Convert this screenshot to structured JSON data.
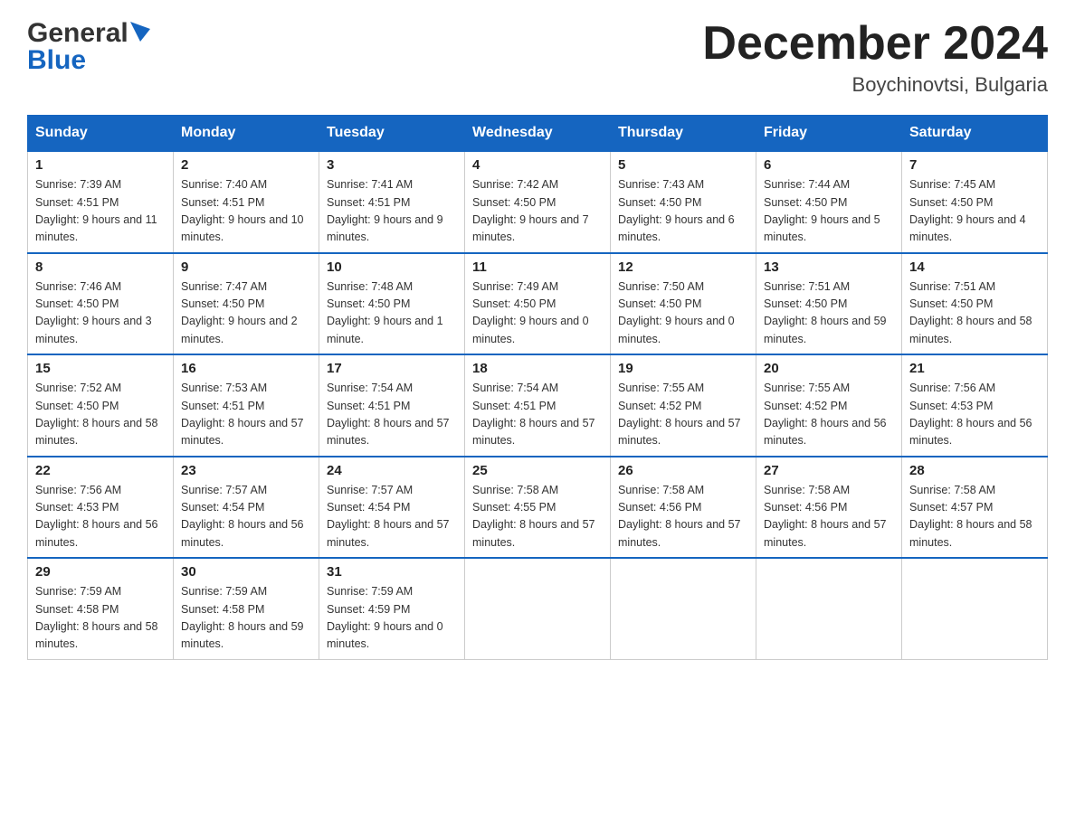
{
  "header": {
    "logo_general": "General",
    "logo_blue": "Blue",
    "month_title": "December 2024",
    "location": "Boychinovtsi, Bulgaria"
  },
  "days_of_week": [
    "Sunday",
    "Monday",
    "Tuesday",
    "Wednesday",
    "Thursday",
    "Friday",
    "Saturday"
  ],
  "weeks": [
    [
      {
        "day": "1",
        "sunrise": "Sunrise: 7:39 AM",
        "sunset": "Sunset: 4:51 PM",
        "daylight": "Daylight: 9 hours and 11 minutes."
      },
      {
        "day": "2",
        "sunrise": "Sunrise: 7:40 AM",
        "sunset": "Sunset: 4:51 PM",
        "daylight": "Daylight: 9 hours and 10 minutes."
      },
      {
        "day": "3",
        "sunrise": "Sunrise: 7:41 AM",
        "sunset": "Sunset: 4:51 PM",
        "daylight": "Daylight: 9 hours and 9 minutes."
      },
      {
        "day": "4",
        "sunrise": "Sunrise: 7:42 AM",
        "sunset": "Sunset: 4:50 PM",
        "daylight": "Daylight: 9 hours and 7 minutes."
      },
      {
        "day": "5",
        "sunrise": "Sunrise: 7:43 AM",
        "sunset": "Sunset: 4:50 PM",
        "daylight": "Daylight: 9 hours and 6 minutes."
      },
      {
        "day": "6",
        "sunrise": "Sunrise: 7:44 AM",
        "sunset": "Sunset: 4:50 PM",
        "daylight": "Daylight: 9 hours and 5 minutes."
      },
      {
        "day": "7",
        "sunrise": "Sunrise: 7:45 AM",
        "sunset": "Sunset: 4:50 PM",
        "daylight": "Daylight: 9 hours and 4 minutes."
      }
    ],
    [
      {
        "day": "8",
        "sunrise": "Sunrise: 7:46 AM",
        "sunset": "Sunset: 4:50 PM",
        "daylight": "Daylight: 9 hours and 3 minutes."
      },
      {
        "day": "9",
        "sunrise": "Sunrise: 7:47 AM",
        "sunset": "Sunset: 4:50 PM",
        "daylight": "Daylight: 9 hours and 2 minutes."
      },
      {
        "day": "10",
        "sunrise": "Sunrise: 7:48 AM",
        "sunset": "Sunset: 4:50 PM",
        "daylight": "Daylight: 9 hours and 1 minute."
      },
      {
        "day": "11",
        "sunrise": "Sunrise: 7:49 AM",
        "sunset": "Sunset: 4:50 PM",
        "daylight": "Daylight: 9 hours and 0 minutes."
      },
      {
        "day": "12",
        "sunrise": "Sunrise: 7:50 AM",
        "sunset": "Sunset: 4:50 PM",
        "daylight": "Daylight: 9 hours and 0 minutes."
      },
      {
        "day": "13",
        "sunrise": "Sunrise: 7:51 AM",
        "sunset": "Sunset: 4:50 PM",
        "daylight": "Daylight: 8 hours and 59 minutes."
      },
      {
        "day": "14",
        "sunrise": "Sunrise: 7:51 AM",
        "sunset": "Sunset: 4:50 PM",
        "daylight": "Daylight: 8 hours and 58 minutes."
      }
    ],
    [
      {
        "day": "15",
        "sunrise": "Sunrise: 7:52 AM",
        "sunset": "Sunset: 4:50 PM",
        "daylight": "Daylight: 8 hours and 58 minutes."
      },
      {
        "day": "16",
        "sunrise": "Sunrise: 7:53 AM",
        "sunset": "Sunset: 4:51 PM",
        "daylight": "Daylight: 8 hours and 57 minutes."
      },
      {
        "day": "17",
        "sunrise": "Sunrise: 7:54 AM",
        "sunset": "Sunset: 4:51 PM",
        "daylight": "Daylight: 8 hours and 57 minutes."
      },
      {
        "day": "18",
        "sunrise": "Sunrise: 7:54 AM",
        "sunset": "Sunset: 4:51 PM",
        "daylight": "Daylight: 8 hours and 57 minutes."
      },
      {
        "day": "19",
        "sunrise": "Sunrise: 7:55 AM",
        "sunset": "Sunset: 4:52 PM",
        "daylight": "Daylight: 8 hours and 57 minutes."
      },
      {
        "day": "20",
        "sunrise": "Sunrise: 7:55 AM",
        "sunset": "Sunset: 4:52 PM",
        "daylight": "Daylight: 8 hours and 56 minutes."
      },
      {
        "day": "21",
        "sunrise": "Sunrise: 7:56 AM",
        "sunset": "Sunset: 4:53 PM",
        "daylight": "Daylight: 8 hours and 56 minutes."
      }
    ],
    [
      {
        "day": "22",
        "sunrise": "Sunrise: 7:56 AM",
        "sunset": "Sunset: 4:53 PM",
        "daylight": "Daylight: 8 hours and 56 minutes."
      },
      {
        "day": "23",
        "sunrise": "Sunrise: 7:57 AM",
        "sunset": "Sunset: 4:54 PM",
        "daylight": "Daylight: 8 hours and 56 minutes."
      },
      {
        "day": "24",
        "sunrise": "Sunrise: 7:57 AM",
        "sunset": "Sunset: 4:54 PM",
        "daylight": "Daylight: 8 hours and 57 minutes."
      },
      {
        "day": "25",
        "sunrise": "Sunrise: 7:58 AM",
        "sunset": "Sunset: 4:55 PM",
        "daylight": "Daylight: 8 hours and 57 minutes."
      },
      {
        "day": "26",
        "sunrise": "Sunrise: 7:58 AM",
        "sunset": "Sunset: 4:56 PM",
        "daylight": "Daylight: 8 hours and 57 minutes."
      },
      {
        "day": "27",
        "sunrise": "Sunrise: 7:58 AM",
        "sunset": "Sunset: 4:56 PM",
        "daylight": "Daylight: 8 hours and 57 minutes."
      },
      {
        "day": "28",
        "sunrise": "Sunrise: 7:58 AM",
        "sunset": "Sunset: 4:57 PM",
        "daylight": "Daylight: 8 hours and 58 minutes."
      }
    ],
    [
      {
        "day": "29",
        "sunrise": "Sunrise: 7:59 AM",
        "sunset": "Sunset: 4:58 PM",
        "daylight": "Daylight: 8 hours and 58 minutes."
      },
      {
        "day": "30",
        "sunrise": "Sunrise: 7:59 AM",
        "sunset": "Sunset: 4:58 PM",
        "daylight": "Daylight: 8 hours and 59 minutes."
      },
      {
        "day": "31",
        "sunrise": "Sunrise: 7:59 AM",
        "sunset": "Sunset: 4:59 PM",
        "daylight": "Daylight: 9 hours and 0 minutes."
      },
      null,
      null,
      null,
      null
    ]
  ]
}
